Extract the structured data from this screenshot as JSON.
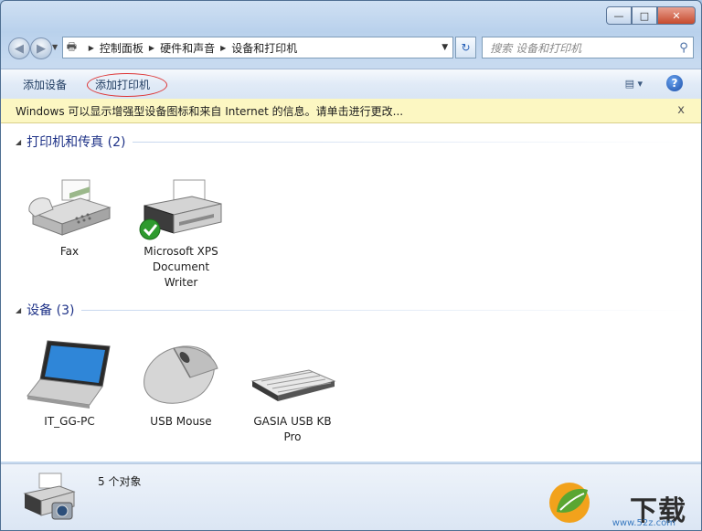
{
  "address_bar": {
    "crumbs": [
      "控制面板",
      "硬件和声音",
      "设备和打印机"
    ]
  },
  "search": {
    "placeholder": "搜索 设备和打印机"
  },
  "toolbar": {
    "add_device": "添加设备",
    "add_printer": "添加打印机"
  },
  "infobar": {
    "message": "Windows 可以显示增强型设备图标和来自 Internet 的信息。请单击进行更改...",
    "close": "x"
  },
  "groups": [
    {
      "title": "打印机和传真 (2)",
      "items": [
        {
          "label": "Fax",
          "icon": "fax-machine-icon"
        },
        {
          "label": "Microsoft XPS Document Writer",
          "icon": "printer-icon",
          "default": true
        }
      ]
    },
    {
      "title": "设备 (3)",
      "items": [
        {
          "label": "IT_GG-PC",
          "icon": "laptop-icon"
        },
        {
          "label": "USB Mouse",
          "icon": "mouse-icon"
        },
        {
          "label": "GASIA USB KB Pro",
          "icon": "keyboard-icon"
        }
      ]
    }
  ],
  "status_bar": {
    "count": "5 个对象"
  },
  "watermark": {
    "brand": "下载",
    "url": "www.52z.com"
  },
  "colors": {
    "group_title": "#1e3287",
    "infobar_bg": "#fcf7c2",
    "highlight_oval": "#dd3333"
  }
}
